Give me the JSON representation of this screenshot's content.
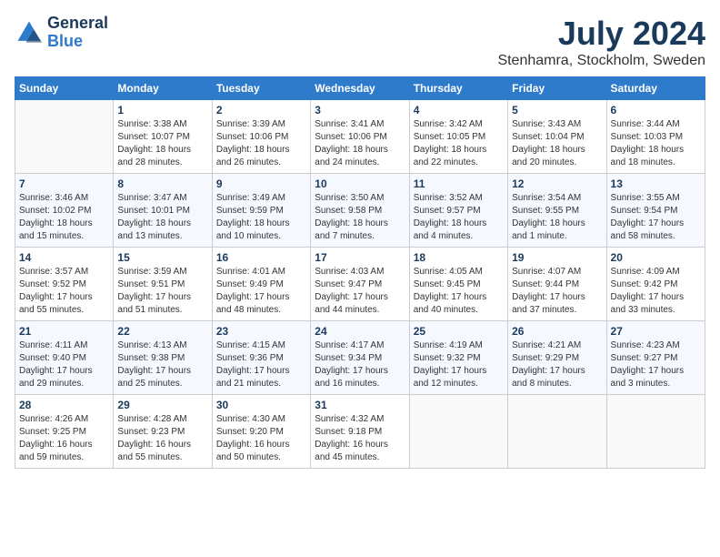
{
  "header": {
    "logo_line1": "General",
    "logo_line2": "Blue",
    "month_title": "July 2024",
    "location": "Stenhamra, Stockholm, Sweden"
  },
  "days_of_week": [
    "Sunday",
    "Monday",
    "Tuesday",
    "Wednesday",
    "Thursday",
    "Friday",
    "Saturday"
  ],
  "weeks": [
    [
      {
        "num": "",
        "empty": true
      },
      {
        "num": "1",
        "sunrise": "Sunrise: 3:38 AM",
        "sunset": "Sunset: 10:07 PM",
        "daylight": "Daylight: 18 hours and 28 minutes."
      },
      {
        "num": "2",
        "sunrise": "Sunrise: 3:39 AM",
        "sunset": "Sunset: 10:06 PM",
        "daylight": "Daylight: 18 hours and 26 minutes."
      },
      {
        "num": "3",
        "sunrise": "Sunrise: 3:41 AM",
        "sunset": "Sunset: 10:06 PM",
        "daylight": "Daylight: 18 hours and 24 minutes."
      },
      {
        "num": "4",
        "sunrise": "Sunrise: 3:42 AM",
        "sunset": "Sunset: 10:05 PM",
        "daylight": "Daylight: 18 hours and 22 minutes."
      },
      {
        "num": "5",
        "sunrise": "Sunrise: 3:43 AM",
        "sunset": "Sunset: 10:04 PM",
        "daylight": "Daylight: 18 hours and 20 minutes."
      },
      {
        "num": "6",
        "sunrise": "Sunrise: 3:44 AM",
        "sunset": "Sunset: 10:03 PM",
        "daylight": "Daylight: 18 hours and 18 minutes."
      }
    ],
    [
      {
        "num": "7",
        "sunrise": "Sunrise: 3:46 AM",
        "sunset": "Sunset: 10:02 PM",
        "daylight": "Daylight: 18 hours and 15 minutes."
      },
      {
        "num": "8",
        "sunrise": "Sunrise: 3:47 AM",
        "sunset": "Sunset: 10:01 PM",
        "daylight": "Daylight: 18 hours and 13 minutes."
      },
      {
        "num": "9",
        "sunrise": "Sunrise: 3:49 AM",
        "sunset": "Sunset: 9:59 PM",
        "daylight": "Daylight: 18 hours and 10 minutes."
      },
      {
        "num": "10",
        "sunrise": "Sunrise: 3:50 AM",
        "sunset": "Sunset: 9:58 PM",
        "daylight": "Daylight: 18 hours and 7 minutes."
      },
      {
        "num": "11",
        "sunrise": "Sunrise: 3:52 AM",
        "sunset": "Sunset: 9:57 PM",
        "daylight": "Daylight: 18 hours and 4 minutes."
      },
      {
        "num": "12",
        "sunrise": "Sunrise: 3:54 AM",
        "sunset": "Sunset: 9:55 PM",
        "daylight": "Daylight: 18 hours and 1 minute."
      },
      {
        "num": "13",
        "sunrise": "Sunrise: 3:55 AM",
        "sunset": "Sunset: 9:54 PM",
        "daylight": "Daylight: 17 hours and 58 minutes."
      }
    ],
    [
      {
        "num": "14",
        "sunrise": "Sunrise: 3:57 AM",
        "sunset": "Sunset: 9:52 PM",
        "daylight": "Daylight: 17 hours and 55 minutes."
      },
      {
        "num": "15",
        "sunrise": "Sunrise: 3:59 AM",
        "sunset": "Sunset: 9:51 PM",
        "daylight": "Daylight: 17 hours and 51 minutes."
      },
      {
        "num": "16",
        "sunrise": "Sunrise: 4:01 AM",
        "sunset": "Sunset: 9:49 PM",
        "daylight": "Daylight: 17 hours and 48 minutes."
      },
      {
        "num": "17",
        "sunrise": "Sunrise: 4:03 AM",
        "sunset": "Sunset: 9:47 PM",
        "daylight": "Daylight: 17 hours and 44 minutes."
      },
      {
        "num": "18",
        "sunrise": "Sunrise: 4:05 AM",
        "sunset": "Sunset: 9:45 PM",
        "daylight": "Daylight: 17 hours and 40 minutes."
      },
      {
        "num": "19",
        "sunrise": "Sunrise: 4:07 AM",
        "sunset": "Sunset: 9:44 PM",
        "daylight": "Daylight: 17 hours and 37 minutes."
      },
      {
        "num": "20",
        "sunrise": "Sunrise: 4:09 AM",
        "sunset": "Sunset: 9:42 PM",
        "daylight": "Daylight: 17 hours and 33 minutes."
      }
    ],
    [
      {
        "num": "21",
        "sunrise": "Sunrise: 4:11 AM",
        "sunset": "Sunset: 9:40 PM",
        "daylight": "Daylight: 17 hours and 29 minutes."
      },
      {
        "num": "22",
        "sunrise": "Sunrise: 4:13 AM",
        "sunset": "Sunset: 9:38 PM",
        "daylight": "Daylight: 17 hours and 25 minutes."
      },
      {
        "num": "23",
        "sunrise": "Sunrise: 4:15 AM",
        "sunset": "Sunset: 9:36 PM",
        "daylight": "Daylight: 17 hours and 21 minutes."
      },
      {
        "num": "24",
        "sunrise": "Sunrise: 4:17 AM",
        "sunset": "Sunset: 9:34 PM",
        "daylight": "Daylight: 17 hours and 16 minutes."
      },
      {
        "num": "25",
        "sunrise": "Sunrise: 4:19 AM",
        "sunset": "Sunset: 9:32 PM",
        "daylight": "Daylight: 17 hours and 12 minutes."
      },
      {
        "num": "26",
        "sunrise": "Sunrise: 4:21 AM",
        "sunset": "Sunset: 9:29 PM",
        "daylight": "Daylight: 17 hours and 8 minutes."
      },
      {
        "num": "27",
        "sunrise": "Sunrise: 4:23 AM",
        "sunset": "Sunset: 9:27 PM",
        "daylight": "Daylight: 17 hours and 3 minutes."
      }
    ],
    [
      {
        "num": "28",
        "sunrise": "Sunrise: 4:26 AM",
        "sunset": "Sunset: 9:25 PM",
        "daylight": "Daylight: 16 hours and 59 minutes."
      },
      {
        "num": "29",
        "sunrise": "Sunrise: 4:28 AM",
        "sunset": "Sunset: 9:23 PM",
        "daylight": "Daylight: 16 hours and 55 minutes."
      },
      {
        "num": "30",
        "sunrise": "Sunrise: 4:30 AM",
        "sunset": "Sunset: 9:20 PM",
        "daylight": "Daylight: 16 hours and 50 minutes."
      },
      {
        "num": "31",
        "sunrise": "Sunrise: 4:32 AM",
        "sunset": "Sunset: 9:18 PM",
        "daylight": "Daylight: 16 hours and 45 minutes."
      },
      {
        "num": "",
        "empty": true
      },
      {
        "num": "",
        "empty": true
      },
      {
        "num": "",
        "empty": true
      }
    ]
  ]
}
